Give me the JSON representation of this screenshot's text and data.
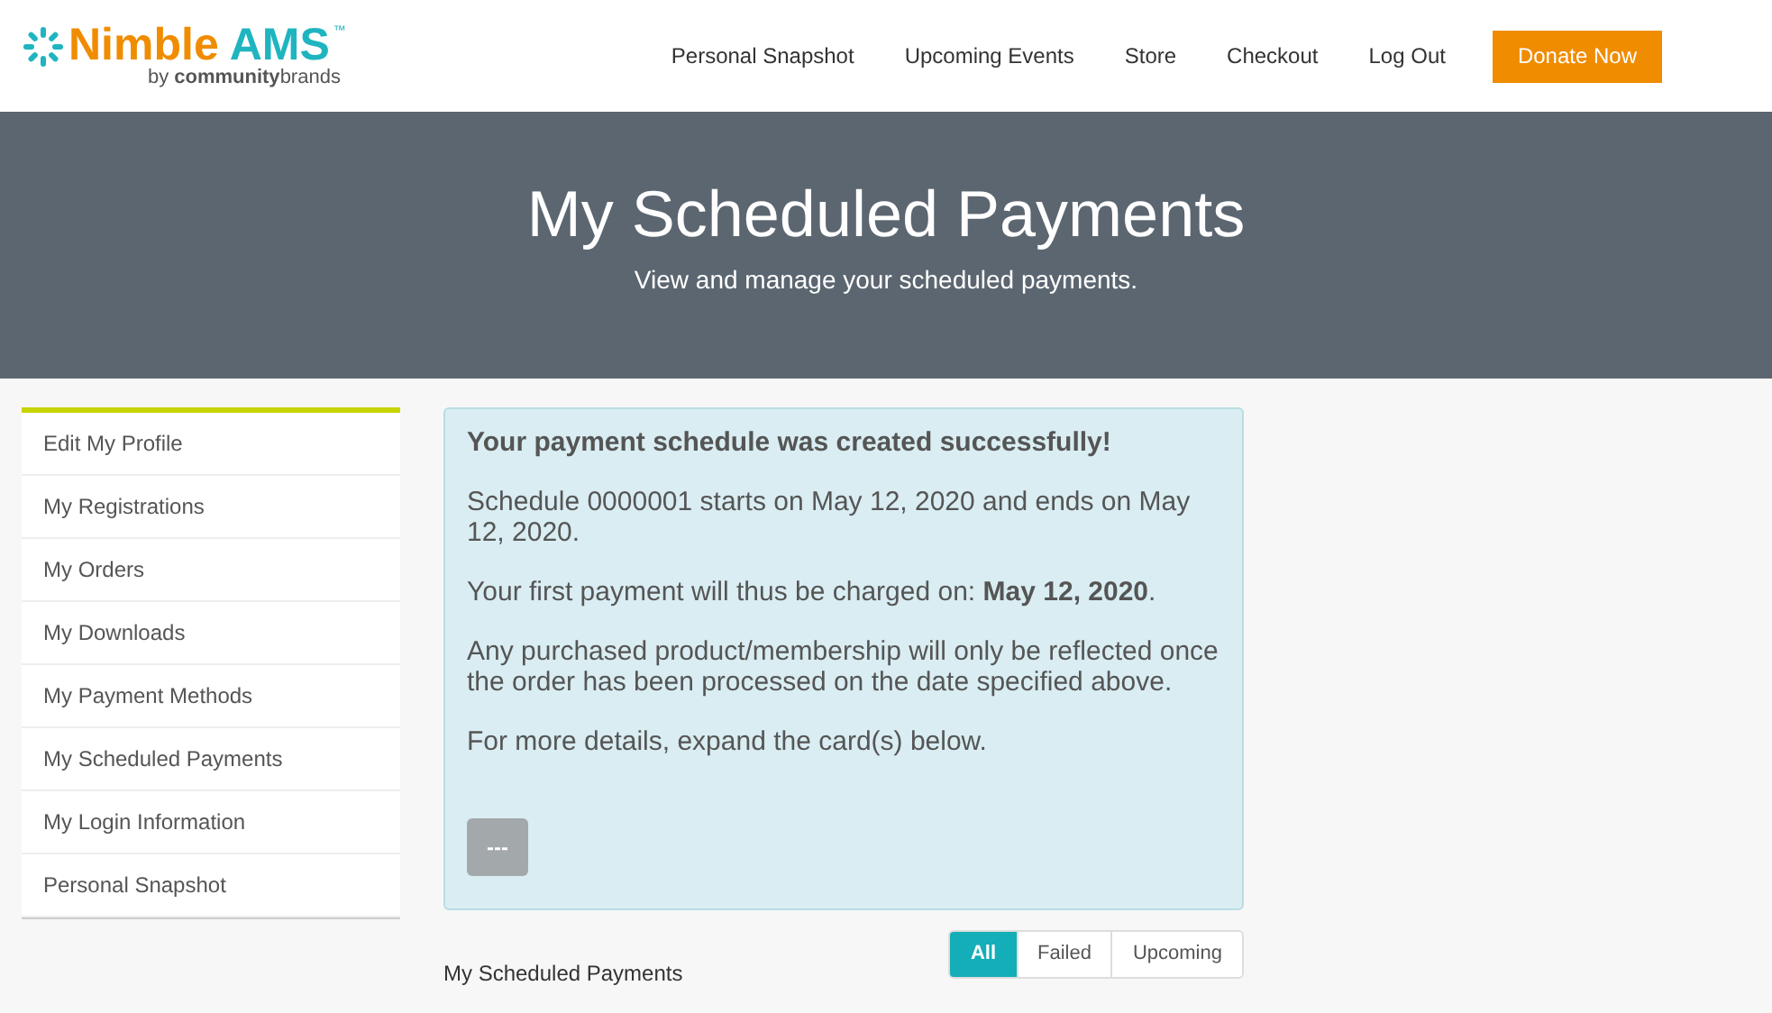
{
  "logo": {
    "word_1": "Nimble",
    "word_2": "AMS",
    "trademark": "™",
    "tagline_prefix": "by",
    "tagline_bold": "community",
    "tagline_rest": "brands"
  },
  "nav": [
    "Personal Snapshot",
    "Upcoming Events",
    "Store",
    "Checkout",
    "Log Out"
  ],
  "donate_button": "Donate Now",
  "banner": {
    "title": "My Scheduled Payments",
    "subtitle": "View and manage your scheduled payments."
  },
  "sidebar": {
    "items": [
      {
        "label": "Edit My Profile",
        "selected": false
      },
      {
        "label": "My Registrations",
        "selected": false
      },
      {
        "label": "My Orders",
        "selected": false
      },
      {
        "label": "My Downloads",
        "selected": false
      },
      {
        "label": "My Payment Methods",
        "selected": false
      },
      {
        "label": "My Scheduled Payments",
        "selected": false
      },
      {
        "label": "My Login Information",
        "selected": false
      },
      {
        "label": "Personal Snapshot",
        "selected": false
      }
    ]
  },
  "alert": {
    "heading": "Your payment schedule was created successfully!",
    "paragraphs": [
      "Schedule 0000001 starts on May 12, 2020 and ends on May 12, 2020.",
      "Your first payment will thus be charged on: **May 12, 2020**.",
      "Any purchased product/membership will only be reflected once the order has been processed on the date specified above.",
      "For more details, expand the card(s) below."
    ],
    "button": "---"
  },
  "section_title": "My Scheduled Payments",
  "filters": [
    {
      "label": "All",
      "selected": true
    },
    {
      "label": "Failed",
      "selected": false
    },
    {
      "label": "Upcoming",
      "selected": false
    }
  ]
}
